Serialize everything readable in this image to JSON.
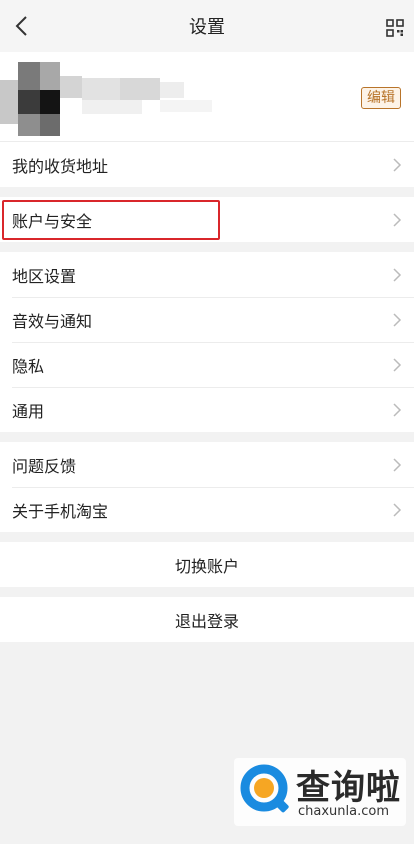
{
  "header": {
    "title": "设置"
  },
  "profile": {
    "edit_label": "编辑"
  },
  "groups": [
    {
      "items": [
        {
          "label": "我的收货地址"
        }
      ]
    },
    {
      "items": [
        {
          "label": "账户与安全",
          "highlighted": true
        }
      ]
    },
    {
      "items": [
        {
          "label": "地区设置"
        },
        {
          "label": "音效与通知"
        },
        {
          "label": "隐私"
        },
        {
          "label": "通用"
        }
      ]
    },
    {
      "items": [
        {
          "label": "问题反馈"
        },
        {
          "label": "关于手机淘宝"
        }
      ]
    }
  ],
  "actions": {
    "switch_account": "切换账户",
    "logout": "退出登录"
  },
  "watermark": {
    "brand": "查询啦",
    "domain": "chaxunla.com"
  },
  "colors": {
    "highlight_border": "#d9262b",
    "edit_badge": "#b8742a",
    "watermark_logo": "#1a8be0"
  },
  "icons": {
    "back": "chevron-left-icon",
    "qr": "qr-code-icon",
    "row_arrow": "chevron-right-icon"
  }
}
